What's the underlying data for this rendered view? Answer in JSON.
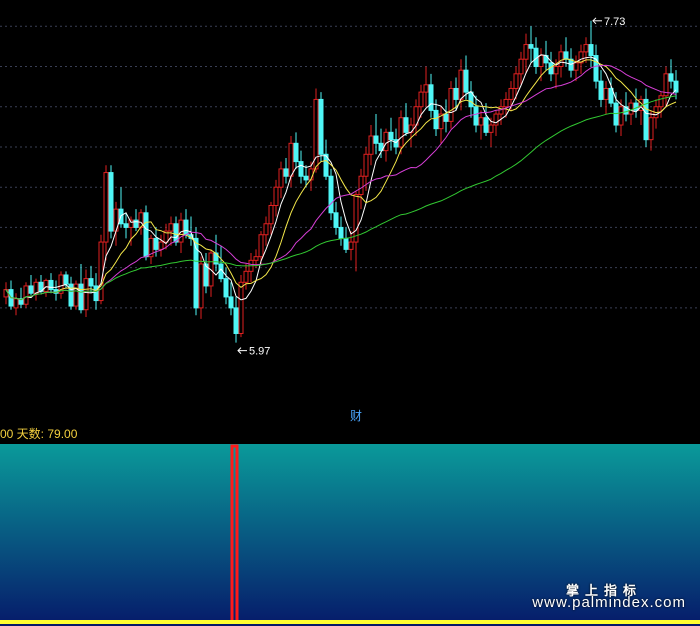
{
  "indicator_header": {
    "text": "00 天数: 79.00"
  },
  "watermark": {
    "title": "掌上指标",
    "url": "www.palmindex.com"
  },
  "colors": {
    "up": "#e02020",
    "down": "#4ff6f6",
    "ma5": "#ffffff",
    "ma10": "#f4e84a",
    "ma20": "#d63fd6",
    "ma60": "#32c832",
    "grid": "#3a3f55",
    "annotation": "#ffffff",
    "fin_marker": "#4aa6ff",
    "indicator_top": "#0a9a9a",
    "indicator_bottom": "#061a6a",
    "signal": "#ff1a1a",
    "baseline": "#ffff33"
  },
  "chart_data": {
    "type": "candlestick",
    "title": "",
    "xlabel": "",
    "ylabel": "",
    "ylim": [
      5.7,
      7.8
    ],
    "grid": true,
    "annotations": [
      {
        "label": "7.73",
        "kind": "high",
        "bar_index": 117
      },
      {
        "label": "5.97",
        "kind": "low",
        "bar_index": 46
      }
    ],
    "event_marker": {
      "label": "财",
      "bar_index": 70
    },
    "moving_averages": [
      {
        "period": 5,
        "color": "#ffffff"
      },
      {
        "period": 10,
        "color": "#f4e84a"
      },
      {
        "period": 20,
        "color": "#d63fd6"
      },
      {
        "period": 60,
        "color": "#32c832"
      }
    ],
    "candles": [
      [
        6.22,
        6.3,
        6.18,
        6.26
      ],
      [
        6.26,
        6.31,
        6.15,
        6.17
      ],
      [
        6.16,
        6.24,
        6.12,
        6.21
      ],
      [
        6.21,
        6.27,
        6.16,
        6.18
      ],
      [
        6.18,
        6.3,
        6.16,
        6.28
      ],
      [
        6.28,
        6.34,
        6.23,
        6.24
      ],
      [
        6.24,
        6.32,
        6.2,
        6.3
      ],
      [
        6.3,
        6.34,
        6.24,
        6.25
      ],
      [
        6.25,
        6.32,
        6.22,
        6.31
      ],
      [
        6.31,
        6.35,
        6.24,
        6.26
      ],
      [
        6.26,
        6.31,
        6.2,
        6.24
      ],
      [
        6.24,
        6.36,
        6.21,
        6.34
      ],
      [
        6.34,
        6.36,
        6.27,
        6.29
      ],
      [
        6.29,
        6.33,
        6.15,
        6.17
      ],
      [
        6.17,
        6.31,
        6.15,
        6.29
      ],
      [
        6.29,
        6.4,
        6.13,
        6.15
      ],
      [
        6.15,
        6.37,
        6.11,
        6.32
      ],
      [
        6.32,
        6.39,
        6.24,
        6.28
      ],
      [
        6.28,
        6.35,
        6.15,
        6.2
      ],
      [
        6.2,
        6.56,
        6.18,
        6.52
      ],
      [
        6.52,
        6.94,
        6.42,
        6.9
      ],
      [
        6.9,
        6.94,
        6.54,
        6.58
      ],
      [
        6.58,
        6.74,
        6.5,
        6.7
      ],
      [
        6.7,
        6.82,
        6.6,
        6.62
      ],
      [
        6.62,
        6.68,
        6.54,
        6.6
      ],
      [
        6.6,
        6.66,
        6.5,
        6.64
      ],
      [
        6.64,
        6.7,
        6.58,
        6.6
      ],
      [
        6.6,
        6.7,
        6.56,
        6.68
      ],
      [
        6.68,
        6.72,
        6.42,
        6.44
      ],
      [
        6.44,
        6.56,
        6.4,
        6.54
      ],
      [
        6.54,
        6.6,
        6.44,
        6.48
      ],
      [
        6.48,
        6.56,
        6.44,
        6.52
      ],
      [
        6.52,
        6.62,
        6.48,
        6.58
      ],
      [
        6.58,
        6.66,
        6.5,
        6.62
      ],
      [
        6.62,
        6.66,
        6.5,
        6.52
      ],
      [
        6.52,
        6.68,
        6.46,
        6.64
      ],
      [
        6.64,
        6.7,
        6.54,
        6.56
      ],
      [
        6.56,
        6.66,
        6.5,
        6.54
      ],
      [
        6.54,
        6.6,
        6.12,
        6.16
      ],
      [
        6.16,
        6.44,
        6.1,
        6.4
      ],
      [
        6.4,
        6.46,
        6.24,
        6.28
      ],
      [
        6.28,
        6.48,
        6.22,
        6.46
      ],
      [
        6.46,
        6.56,
        6.36,
        6.4
      ],
      [
        6.4,
        6.5,
        6.3,
        6.32
      ],
      [
        6.32,
        6.38,
        6.18,
        6.22
      ],
      [
        6.22,
        6.3,
        6.12,
        6.16
      ],
      [
        6.16,
        6.22,
        5.97,
        6.02
      ],
      [
        6.02,
        6.34,
        6.0,
        6.3
      ],
      [
        6.3,
        6.4,
        6.26,
        6.36
      ],
      [
        6.36,
        6.46,
        6.3,
        6.42
      ],
      [
        6.42,
        6.48,
        6.38,
        6.44
      ],
      [
        6.44,
        6.58,
        6.4,
        6.56
      ],
      [
        6.56,
        6.66,
        6.5,
        6.62
      ],
      [
        6.62,
        6.74,
        6.56,
        6.72
      ],
      [
        6.72,
        6.86,
        6.66,
        6.82
      ],
      [
        6.82,
        6.96,
        6.76,
        6.92
      ],
      [
        6.92,
        6.98,
        6.84,
        6.88
      ],
      [
        6.88,
        7.1,
        6.82,
        7.06
      ],
      [
        7.06,
        7.12,
        6.92,
        6.96
      ],
      [
        6.96,
        7.02,
        6.84,
        6.88
      ],
      [
        6.88,
        6.94,
        6.82,
        6.86
      ],
      [
        6.86,
        6.96,
        6.8,
        6.92
      ],
      [
        6.92,
        7.36,
        6.9,
        7.3
      ],
      [
        7.3,
        7.34,
        6.96,
        7.0
      ],
      [
        7.0,
        7.08,
        6.86,
        6.88
      ],
      [
        6.88,
        6.92,
        6.64,
        6.68
      ],
      [
        6.68,
        6.74,
        6.56,
        6.6
      ],
      [
        6.6,
        6.66,
        6.5,
        6.54
      ],
      [
        6.54,
        6.6,
        6.46,
        6.48
      ],
      [
        6.48,
        6.58,
        6.42,
        6.52
      ],
      [
        6.52,
        6.8,
        6.36,
        6.78
      ],
      [
        6.78,
        6.92,
        6.7,
        6.88
      ],
      [
        6.88,
        7.04,
        6.8,
        7.0
      ],
      [
        7.0,
        7.16,
        6.94,
        7.1
      ],
      [
        7.1,
        7.22,
        7.0,
        7.06
      ],
      [
        7.06,
        7.14,
        6.98,
        7.02
      ],
      [
        7.02,
        7.14,
        6.96,
        7.12
      ],
      [
        7.12,
        7.2,
        7.02,
        7.08
      ],
      [
        7.08,
        7.14,
        7.0,
        7.04
      ],
      [
        7.04,
        7.24,
        7.0,
        7.2
      ],
      [
        7.2,
        7.28,
        7.1,
        7.12
      ],
      [
        7.12,
        7.2,
        7.04,
        7.16
      ],
      [
        7.16,
        7.3,
        7.1,
        7.26
      ],
      [
        7.26,
        7.38,
        7.2,
        7.34
      ],
      [
        7.34,
        7.48,
        7.26,
        7.38
      ],
      [
        7.38,
        7.44,
        7.2,
        7.24
      ],
      [
        7.24,
        7.3,
        7.1,
        7.14
      ],
      [
        7.14,
        7.26,
        7.06,
        7.22
      ],
      [
        7.22,
        7.3,
        7.12,
        7.18
      ],
      [
        7.18,
        7.4,
        7.14,
        7.36
      ],
      [
        7.36,
        7.42,
        7.24,
        7.3
      ],
      [
        7.3,
        7.52,
        7.24,
        7.46
      ],
      [
        7.46,
        7.54,
        7.3,
        7.34
      ],
      [
        7.34,
        7.4,
        7.2,
        7.26
      ],
      [
        7.26,
        7.32,
        7.12,
        7.16
      ],
      [
        7.16,
        7.24,
        7.08,
        7.2
      ],
      [
        7.2,
        7.28,
        7.1,
        7.12
      ],
      [
        7.12,
        7.2,
        7.04,
        7.16
      ],
      [
        7.16,
        7.24,
        7.1,
        7.22
      ],
      [
        7.22,
        7.3,
        7.16,
        7.26
      ],
      [
        7.26,
        7.34,
        7.2,
        7.3
      ],
      [
        7.3,
        7.4,
        7.24,
        7.36
      ],
      [
        7.36,
        7.48,
        7.3,
        7.44
      ],
      [
        7.44,
        7.56,
        7.38,
        7.52
      ],
      [
        7.52,
        7.66,
        7.44,
        7.6
      ],
      [
        7.6,
        7.7,
        7.5,
        7.58
      ],
      [
        7.58,
        7.64,
        7.44,
        7.48
      ],
      [
        7.48,
        7.58,
        7.4,
        7.54
      ],
      [
        7.54,
        7.62,
        7.46,
        7.5
      ],
      [
        7.5,
        7.56,
        7.4,
        7.44
      ],
      [
        7.44,
        7.52,
        7.36,
        7.48
      ],
      [
        7.48,
        7.6,
        7.42,
        7.56
      ],
      [
        7.56,
        7.64,
        7.48,
        7.52
      ],
      [
        7.52,
        7.58,
        7.42,
        7.46
      ],
      [
        7.46,
        7.54,
        7.4,
        7.5
      ],
      [
        7.5,
        7.6,
        7.44,
        7.56
      ],
      [
        7.56,
        7.64,
        7.5,
        7.6
      ],
      [
        7.6,
        7.73,
        7.48,
        7.54
      ],
      [
        7.54,
        7.6,
        7.36,
        7.4
      ],
      [
        7.4,
        7.46,
        7.26,
        7.3
      ],
      [
        7.3,
        7.4,
        7.22,
        7.36
      ],
      [
        7.36,
        7.42,
        7.26,
        7.28
      ],
      [
        7.28,
        7.34,
        7.12,
        7.16
      ],
      [
        7.16,
        7.3,
        7.1,
        7.26
      ],
      [
        7.26,
        7.34,
        7.18,
        7.22
      ],
      [
        7.22,
        7.3,
        7.16,
        7.28
      ],
      [
        7.28,
        7.36,
        7.2,
        7.24
      ],
      [
        7.24,
        7.32,
        7.16,
        7.3
      ],
      [
        7.3,
        7.36,
        7.04,
        7.08
      ],
      [
        7.08,
        7.24,
        7.02,
        7.2
      ],
      [
        7.2,
        7.3,
        7.14,
        7.26
      ],
      [
        7.26,
        7.34,
        7.2,
        7.32
      ],
      [
        7.32,
        7.48,
        7.26,
        7.44
      ],
      [
        7.44,
        7.52,
        7.36,
        7.4
      ],
      [
        7.4,
        7.46,
        7.3,
        7.34
      ]
    ],
    "indicator": {
      "label": "天数",
      "value": 79.0,
      "signals": [
        {
          "bar_index": 46,
          "value": 1
        },
        {
          "bar_index": 47,
          "value": 1
        }
      ]
    }
  }
}
